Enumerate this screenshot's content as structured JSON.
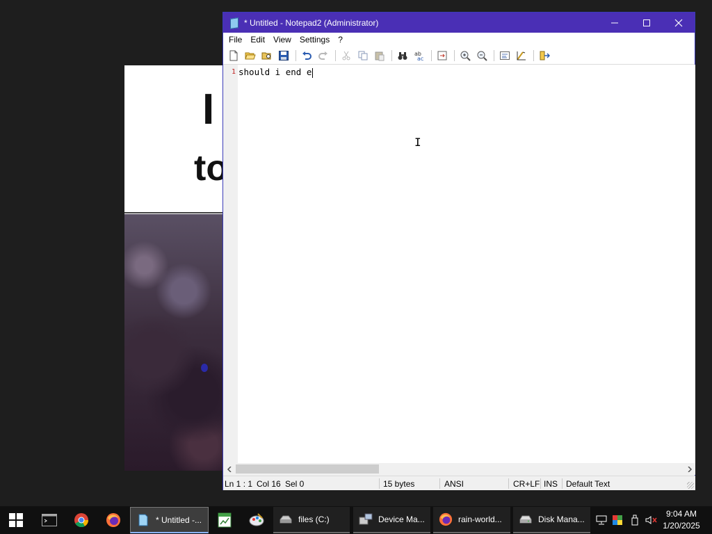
{
  "notepad": {
    "title": "* Untitled - Notepad2 (Administrator)",
    "controls": {
      "minimize": "—",
      "maximize": "☐",
      "close": "✕"
    },
    "menu": [
      "File",
      "Edit",
      "View",
      "Settings",
      "?"
    ],
    "toolbar": [
      "new-file",
      "open",
      "browse",
      "save",
      "undo",
      "redo",
      "cut",
      "copy",
      "paste",
      "find",
      "replace",
      "goto",
      "zoom-in",
      "zoom-out",
      "word-wrap",
      "scheme",
      "exit"
    ],
    "editor": {
      "line_number": "1",
      "content": "should i end e"
    },
    "status": {
      "position": "Ln 1 : 1",
      "column": "Col 16",
      "selection": "Sel 0",
      "size": "15 bytes",
      "encoding": "ANSI",
      "line_endings": "CR+LF",
      "mode": "INS",
      "scheme": "Default Text"
    }
  },
  "background_window": {
    "letters": [
      "I",
      "to"
    ]
  },
  "taskbar": {
    "items": [
      {
        "label": "* Untitled -...",
        "icon": "notepad-icon",
        "active": true
      },
      {
        "label": "files (C:)",
        "icon": "drive-icon",
        "active": false
      },
      {
        "label": "Device Ma...",
        "icon": "device-manager-icon",
        "active": false
      },
      {
        "label": "rain-world...",
        "icon": "firefox-icon",
        "active": false
      },
      {
        "label": "Disk Mana...",
        "icon": "disk-management-icon",
        "active": false
      }
    ],
    "clock": {
      "time": "9:04 AM",
      "date": "1/20/2025"
    }
  },
  "colors": {
    "titlebar": "#4a2fb5",
    "taskbar": "#101010",
    "accent": "#8ab4f8"
  }
}
